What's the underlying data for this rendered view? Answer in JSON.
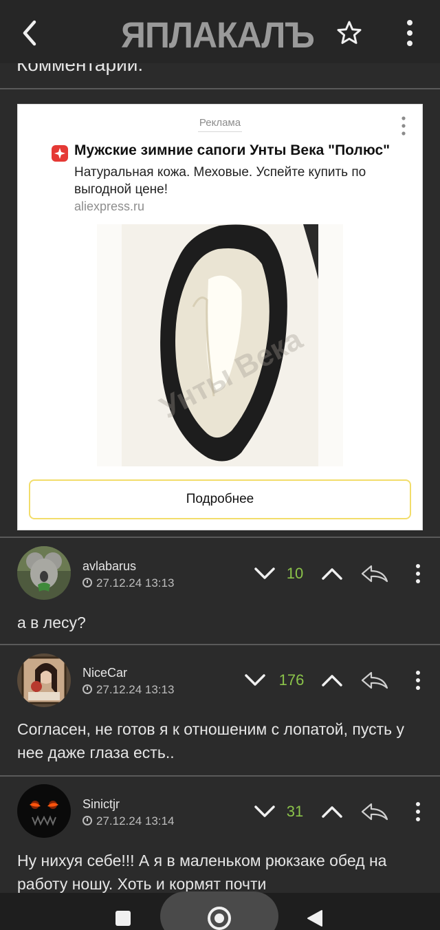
{
  "header": {
    "logo_text": "ЯПЛАКАЛЪ"
  },
  "section_title": "Комментарии:",
  "ad": {
    "label": "Реклама",
    "title": "Мужские зимние сапоги Унты Века \"Полюс\"",
    "description": "Натуральная кожа. Меховые. Успейте купить по выгодной цене!",
    "domain": "aliexpress.ru",
    "watermark": "Унты Века",
    "cta_label": "Подробнее",
    "accent_color": "#f2dd6a",
    "logo_color": "#e53935"
  },
  "comments": [
    {
      "username": "avlabarus",
      "timestamp": "27.12.24 13:13",
      "score": "10",
      "text": "а в лесу?"
    },
    {
      "username": "NiceCar",
      "timestamp": "27.12.24 13:13",
      "score": "176",
      "text": "Согласен, не готов я к отношеним с лопатой, пусть у нее даже глаза есть.."
    },
    {
      "username": "Sinictjr",
      "timestamp": "27.12.24 13:14",
      "score": "31",
      "text": "Ну нихуя себе!!! А я в маленьком рюкзаке обед на работу ношу. Хоть и кормят почти"
    }
  ],
  "colors": {
    "background": "#2b2b2b",
    "header": "#262626",
    "score": "#8bc34a"
  },
  "icons": {
    "back": "chevron-left-icon",
    "favorite": "star-icon",
    "menu": "kebab-icon",
    "vote_down": "chevron-down-icon",
    "vote_up": "chevron-up-icon",
    "reply": "reply-icon"
  }
}
